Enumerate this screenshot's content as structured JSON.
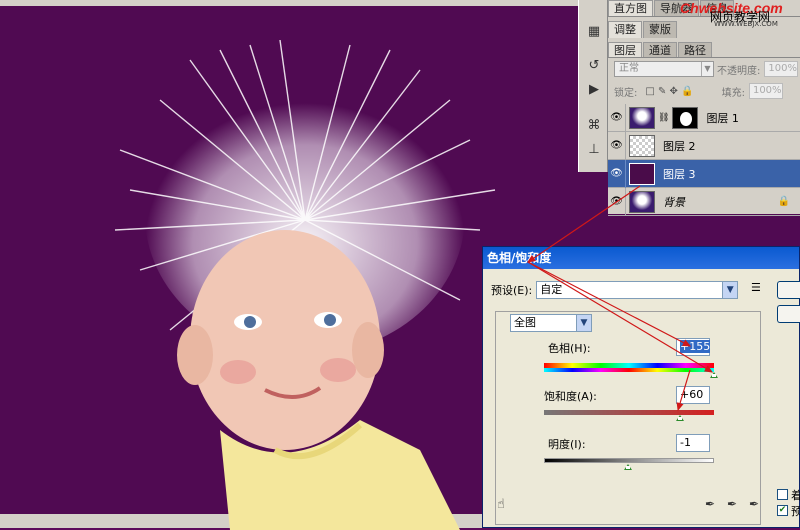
{
  "panel_tabs_top": [
    "直方图",
    "导航器",
    "信息"
  ],
  "brand": {
    "line1": "Chwebsite.com",
    "line2": "网页教学网",
    "line3": "WWW.WEBJX.COM"
  },
  "adjust_tabs": [
    "调整",
    "蒙版"
  ],
  "layers_panel": {
    "tabs": [
      "图层",
      "通道",
      "路径"
    ],
    "blend_mode": "正常",
    "opacity_label": "不透明度:",
    "opacity_value": "100%",
    "lock_label": "锁定:",
    "fill_label": "填充:",
    "fill_value": "100%",
    "layers": [
      {
        "name": "图层 1",
        "selected": false
      },
      {
        "name": "图层 2",
        "selected": false
      },
      {
        "name": "图层 3",
        "selected": true
      },
      {
        "name": "背景",
        "selected": false
      }
    ]
  },
  "dialog": {
    "title": "色相/饱和度",
    "preset_label": "预设(E):",
    "preset_value": "自定",
    "channel_value": "全图",
    "hue_label": "色相(H):",
    "hue_value": "+155",
    "saturation_label": "饱和度(A):",
    "saturation_value": "+60",
    "lightness_label": "明度(I):",
    "lightness_value": "-1",
    "colorize_label": "着",
    "preview_label": "预",
    "preview_checked": true,
    "colorize_checked": false
  },
  "icons": {
    "eye": "eye-icon",
    "menu": "panel-menu-icon",
    "hand": "hand-icon",
    "eyedropper": "eyedropper-icon"
  },
  "colors": {
    "canvas_bg": "#500a52",
    "selection": "#3a62a8",
    "title_bar": "#0a5ad0",
    "arrow": "#d01818"
  }
}
